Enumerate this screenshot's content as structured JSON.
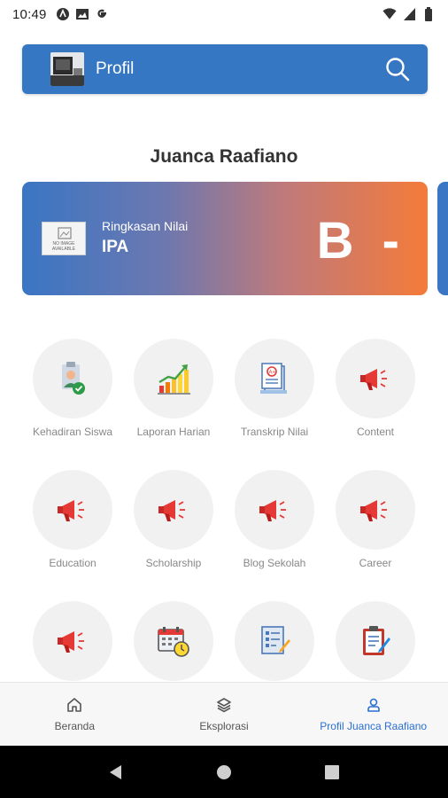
{
  "status_bar": {
    "time": "10:49",
    "left_icons": [
      "android-icon",
      "photo-icon",
      "google-icon"
    ],
    "right_icons": [
      "wifi-icon",
      "signal-icon",
      "battery-icon"
    ]
  },
  "header": {
    "title": "Profil",
    "search_icon": "search-icon"
  },
  "profile": {
    "name": "Juanca Raafiano"
  },
  "grade_card": {
    "noimage_text": "NO IMAGE AVAILABLE",
    "label": "Ringkasan Nilai",
    "subject": "IPA",
    "grade": "B -"
  },
  "menu": {
    "items": [
      {
        "label": "Kehadiran Siswa",
        "icon": "attendance-icon"
      },
      {
        "label": "Laporan Harian",
        "icon": "bar-chart-icon"
      },
      {
        "label": "Transkrip Nilai",
        "icon": "transcript-icon"
      },
      {
        "label": "Content",
        "icon": "megaphone-icon"
      },
      {
        "label": "Education",
        "icon": "megaphone-icon"
      },
      {
        "label": "Scholarship",
        "icon": "megaphone-icon"
      },
      {
        "label": "Blog Sekolah",
        "icon": "megaphone-icon"
      },
      {
        "label": "Career",
        "icon": "megaphone-icon"
      },
      {
        "label": "",
        "icon": "megaphone-icon"
      },
      {
        "label": "",
        "icon": "calendar-clock-icon"
      },
      {
        "label": "",
        "icon": "checklist-icon"
      },
      {
        "label": "",
        "icon": "clipboard-icon"
      }
    ]
  },
  "bottom_nav": {
    "items": [
      {
        "label": "Beranda",
        "icon": "home-icon"
      },
      {
        "label": "Eksplorasi",
        "icon": "layers-icon"
      },
      {
        "label": "Profil Juanca Raafiano",
        "icon": "user-icon"
      }
    ],
    "active_index": 2,
    "active_color": "#2a6fd1"
  },
  "colors": {
    "header": "#3677c3",
    "card_start": "#3a76c4",
    "card_end": "#f47b3a",
    "megaphone": "#e53935"
  }
}
